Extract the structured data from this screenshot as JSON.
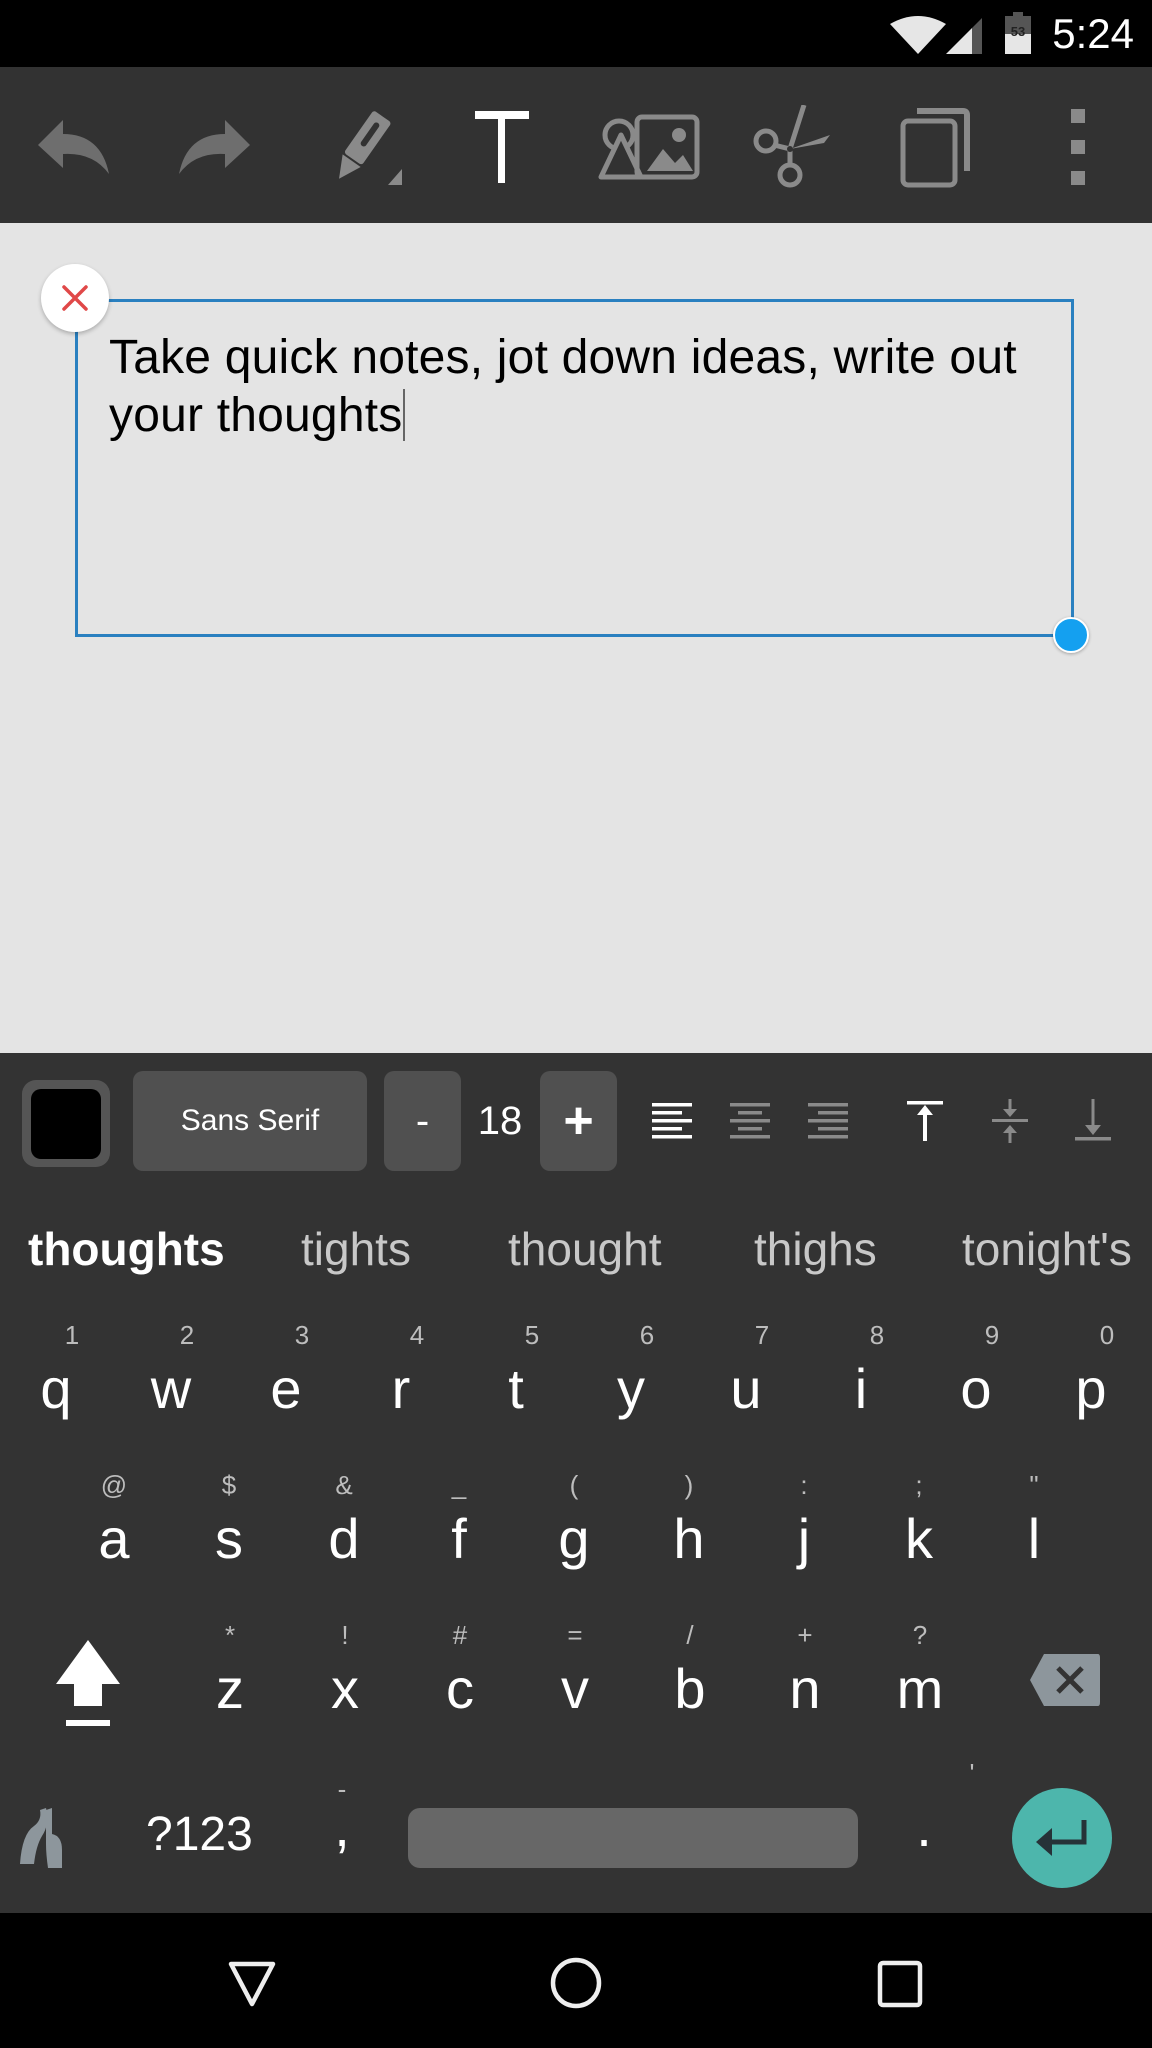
{
  "status_bar": {
    "time": "5:24",
    "battery_level": "53",
    "icons": [
      "wifi-icon",
      "cell-signal-icon",
      "battery-icon"
    ]
  },
  "toolbar": {
    "items": [
      {
        "name": "undo",
        "icon": "undo-icon",
        "active": false
      },
      {
        "name": "redo",
        "icon": "redo-icon",
        "active": false
      },
      {
        "name": "pen",
        "icon": "pen-icon",
        "active": false
      },
      {
        "name": "text",
        "icon": "text-icon",
        "active": true
      },
      {
        "name": "image",
        "icon": "image-icon",
        "active": false
      },
      {
        "name": "cut",
        "icon": "scissors-icon",
        "active": false
      },
      {
        "name": "pages",
        "icon": "copy-icon",
        "active": false
      },
      {
        "name": "more",
        "icon": "more-vert-icon",
        "active": false
      }
    ]
  },
  "canvas": {
    "text_box": {
      "content": "Take quick notes, jot down ideas, write out your thoughts",
      "border_color": "#2a80c0",
      "handle_color": "#14a0f0",
      "close_color": "#e04848"
    }
  },
  "format_bar": {
    "text_color": "#000000",
    "font_family": "Sans Serif",
    "decrease_label": "-",
    "font_size": "18",
    "increase_label": "+",
    "horizontal_align": {
      "options": [
        "left",
        "center",
        "right"
      ],
      "selected": "left"
    },
    "vertical_align": {
      "options": [
        "top",
        "middle",
        "bottom"
      ],
      "selected": "top"
    }
  },
  "keyboard": {
    "suggestions": [
      {
        "text": "thoughts",
        "primary": true
      },
      {
        "text": "tights",
        "primary": false
      },
      {
        "text": "thought",
        "primary": false
      },
      {
        "text": "thighs",
        "primary": false
      },
      {
        "text": "tonight's",
        "primary": false
      }
    ],
    "rows": [
      [
        {
          "main": "q",
          "hint": "1"
        },
        {
          "main": "w",
          "hint": "2"
        },
        {
          "main": "e",
          "hint": "3"
        },
        {
          "main": "r",
          "hint": "4"
        },
        {
          "main": "t",
          "hint": "5"
        },
        {
          "main": "y",
          "hint": "6"
        },
        {
          "main": "u",
          "hint": "7"
        },
        {
          "main": "i",
          "hint": "8"
        },
        {
          "main": "o",
          "hint": "9"
        },
        {
          "main": "p",
          "hint": "0"
        }
      ],
      [
        {
          "main": "a",
          "hint": "@"
        },
        {
          "main": "s",
          "hint": "$"
        },
        {
          "main": "d",
          "hint": "&"
        },
        {
          "main": "f",
          "hint": "_"
        },
        {
          "main": "g",
          "hint": "("
        },
        {
          "main": "h",
          "hint": ")"
        },
        {
          "main": "j",
          "hint": ":"
        },
        {
          "main": "k",
          "hint": ";"
        },
        {
          "main": "l",
          "hint": "\""
        }
      ],
      [
        {
          "main": "z",
          "hint": "*"
        },
        {
          "main": "x",
          "hint": "!"
        },
        {
          "main": "c",
          "hint": "#"
        },
        {
          "main": "v",
          "hint": "="
        },
        {
          "main": "b",
          "hint": "/"
        },
        {
          "main": "n",
          "hint": "+"
        },
        {
          "main": "m",
          "hint": "?"
        }
      ]
    ],
    "bottom_row": {
      "symbols_label": "?123",
      "comma": ",",
      "comma_hint": "-",
      "period": ".",
      "period_hint": "'"
    },
    "enter_color": "#4db6ac"
  },
  "nav_bar": {
    "buttons": [
      "back",
      "home",
      "recents"
    ]
  }
}
